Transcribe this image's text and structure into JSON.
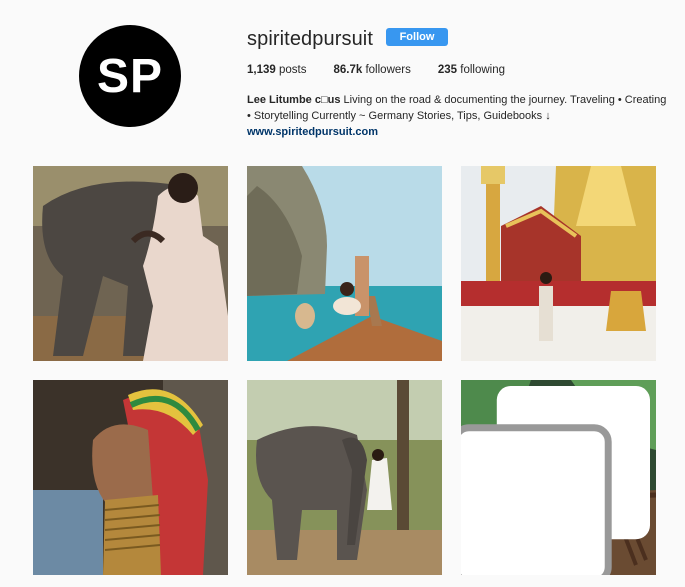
{
  "profile": {
    "avatar_initials": "SP",
    "username": "spiritedpursuit",
    "follow_label": "Follow",
    "stats": {
      "posts_count": "1,139",
      "posts_label": "posts",
      "followers_count": "86.7k",
      "followers_label": "followers",
      "following_count": "235",
      "following_label": "following"
    },
    "bio": {
      "name": "Lee Litumbe c□us",
      "line1_text": "Living on the road & documenting the journey. Traveling • Creating",
      "line2_text": "• Storytelling Currently ~ Germany Stories, Tips, Guidebooks ↓",
      "website": "www.spiritedpursuit.com"
    }
  },
  "posts": [
    {
      "subject": "elephant-and-woman-in-floral-dress"
    },
    {
      "subject": "woman-on-longtail-boat-by-cliffs"
    },
    {
      "subject": "woman-at-golden-temple"
    },
    {
      "subject": "woman-with-neck-rings"
    },
    {
      "subject": "woman-with-elephant-in-forest"
    },
    {
      "subject": "woman-on-stairs-in-garden",
      "icon": "multiple-photos-icon"
    }
  ],
  "colors": {
    "follow_button": "#3897f0",
    "link": "#003569",
    "background": "#fafafa"
  }
}
